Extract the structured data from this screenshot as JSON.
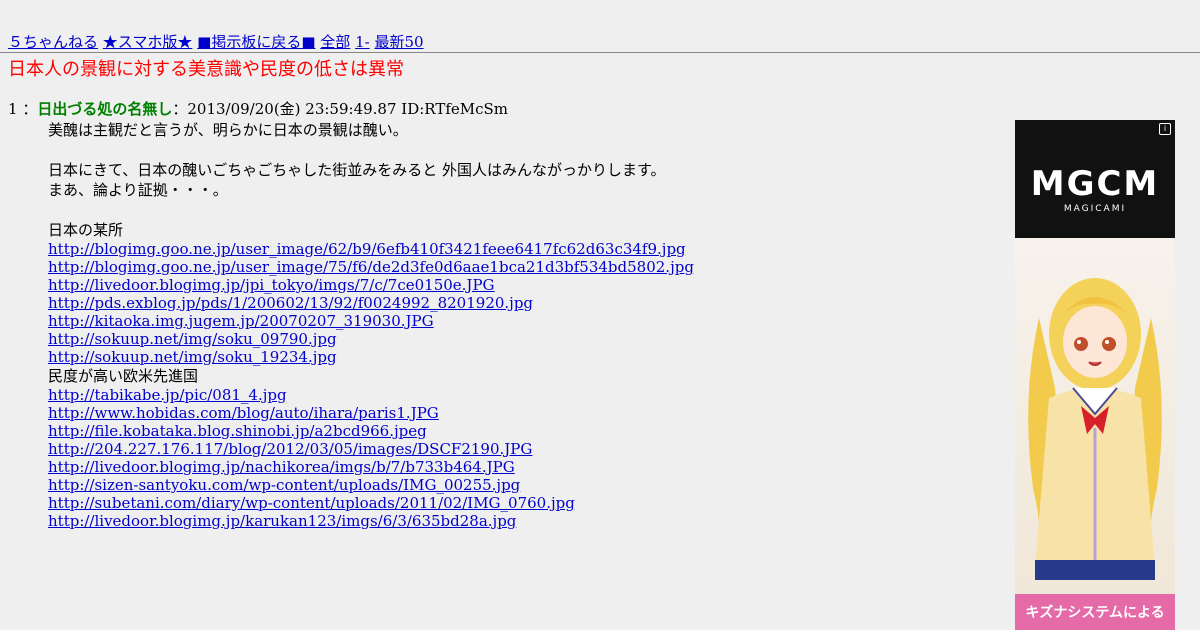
{
  "nav": {
    "items": [
      "５ちゃんねる",
      "★スマホ版★",
      "■掲示板に戻る■",
      "全部",
      "1-",
      "最新50"
    ]
  },
  "thread": {
    "title": "日本人の景観に対する美意識や民度の低さは異常"
  },
  "post": {
    "number": "1",
    "separator": "：",
    "name": "日出づる処の名無し",
    "meta": "：2013/09/20(金) 23:59:49.87 ID:RTfeMcSm",
    "lines": [
      "美醜は主観だと言うが、明らかに日本の景観は醜い。",
      "日本にきて、日本の醜いごちゃごちゃした街並みをみると 外国人はみんながっかりします。",
      "まあ、論より証拠・・・。",
      "日本の某所",
      "民度が高い欧米先進国"
    ],
    "links_japan": [
      "http://blogimg.goo.ne.jp/user_image/62/b9/6efb410f3421feee6417fc62d63c34f9.jpg",
      "http://blogimg.goo.ne.jp/user_image/75/f6/de2d3fe0d6aae1bca21d3bf534bd5802.jpg",
      "http://livedoor.blogimg.jp/jpi_tokyo/imgs/7/c/7ce0150e.JPG",
      "http://pds.exblog.jp/pds/1/200602/13/92/f0024992_8201920.jpg",
      "http://kitaoka.img.jugem.jp/20070207_319030.JPG",
      "http://sokuup.net/img/soku_09790.jpg",
      "http://sokuup.net/img/soku_19234.jpg"
    ],
    "links_west": [
      "http://tabikabe.jp/pic/081_4.jpg",
      "http://www.hobidas.com/blog/auto/ihara/paris1.JPG",
      "http://file.kobataka.blog.shinobi.jp/a2bcd966.jpeg",
      "http://204.227.176.117/blog/2012/03/05/images/DSCF2190.JPG",
      "http://livedoor.blogimg.jp/nachikorea/imgs/b/7/b733b464.JPG",
      "http://sizen-santyoku.com/wp-content/uploads/IMG_00255.jpg",
      "http://subetani.com/diary/wp-content/uploads/2011/02/IMG_0760.jpg",
      "http://livedoor.blogimg.jp/karukan123/imgs/6/3/635bd28a.jpg"
    ]
  },
  "ad": {
    "logo": "MGCM",
    "sub": "MAGICAMI",
    "info": "i",
    "bottom": "キズナシステムによる"
  },
  "colors": {
    "background": "#efefef",
    "link": "#0000cc",
    "title": "#ff0000",
    "name": "#008000"
  }
}
